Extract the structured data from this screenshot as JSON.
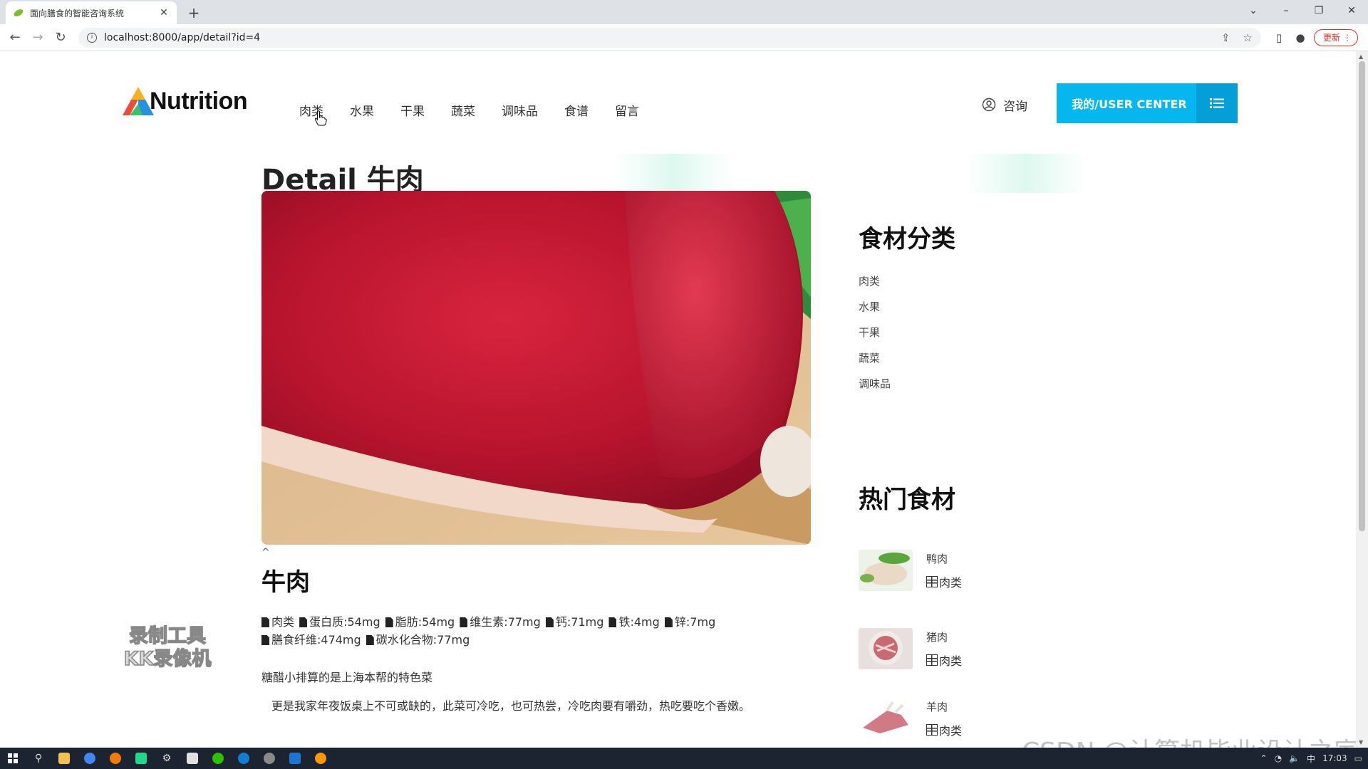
{
  "browser": {
    "tab_title": "面向膳食的智能咨询系统",
    "url": "localhost:8000/app/detail?id=4",
    "update_label": "更新"
  },
  "header": {
    "logo_text": "Nutrition",
    "nav": [
      "肉类",
      "水果",
      "干果",
      "蔬菜",
      "调味品",
      "食谱",
      "留言"
    ],
    "consult_label": "咨询",
    "user_center_label": "我的/USER CENTER"
  },
  "detail": {
    "heading": "Detail 牛肉",
    "caret": "^",
    "name": "牛肉",
    "nutrients": [
      "肉类",
      "蛋白质:54mg",
      "脂肪:54mg",
      "维生素:77mg",
      "钙:71mg",
      "铁:4mg",
      "锌:7mg",
      "膳食纤维:474mg",
      "碳水化合物:77mg"
    ],
    "desc1": "糖醋小排算的是上海本帮的特色菜",
    "desc2": "更是我家年夜饭桌上不可或缺的，此菜可冷吃，也可热尝，冷吃肉要有嚼劲，热吃要吃个香嫩。"
  },
  "sidebar": {
    "categories_title": "食材分类",
    "categories": [
      "肉类",
      "水果",
      "干果",
      "蔬菜",
      "调味品"
    ],
    "hot_title": "热门食材",
    "hot_items": [
      {
        "name": "鸭肉",
        "category": "肉类"
      },
      {
        "name": "猪肉",
        "category": "肉类"
      },
      {
        "name": "羊肉",
        "category": "肉类"
      }
    ]
  },
  "watermarks": {
    "kk_line1": "录制工具",
    "kk_line2": "KK录像机",
    "csdn": "CSDN @计算机毕业设计之家"
  },
  "taskbar": {
    "time": "17:03",
    "ime": "中"
  },
  "colors": {
    "accent": "#06b7ef",
    "accent_dark": "#049fd6"
  }
}
